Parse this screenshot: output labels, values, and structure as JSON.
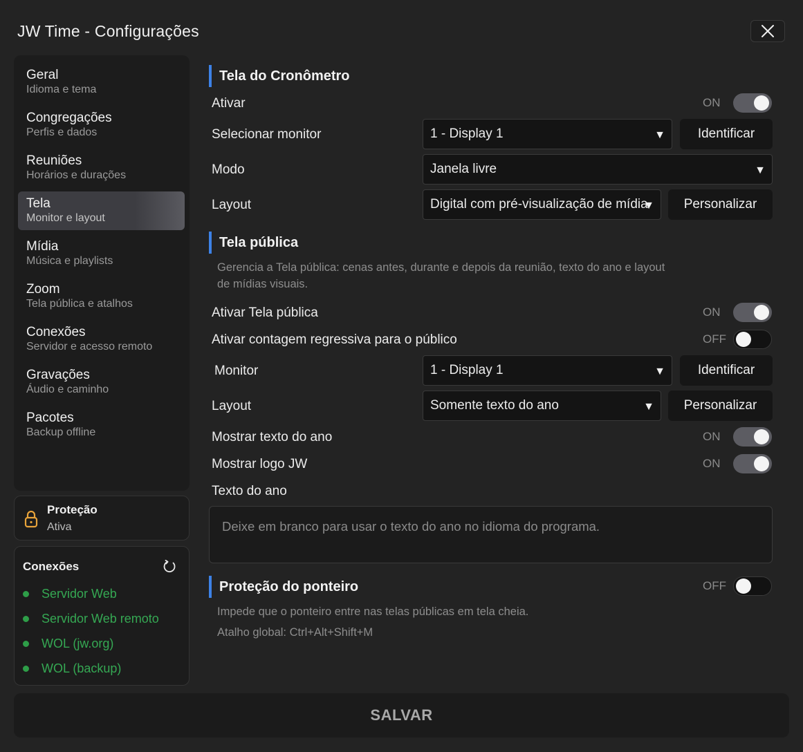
{
  "window": {
    "title": "JW Time - Configurações"
  },
  "sidebar": {
    "items": [
      {
        "label": "Geral",
        "sub": "Idioma e tema"
      },
      {
        "label": "Congregações",
        "sub": "Perfis e dados"
      },
      {
        "label": "Reuniões",
        "sub": "Horários e durações"
      },
      {
        "label": "Tela",
        "sub": "Monitor e layout",
        "active": true
      },
      {
        "label": "Mídia",
        "sub": "Música e playlists"
      },
      {
        "label": "Zoom",
        "sub": "Tela pública e atalhos"
      },
      {
        "label": "Conexões",
        "sub": "Servidor e acesso remoto"
      },
      {
        "label": "Gravações",
        "sub": "Áudio e caminho"
      },
      {
        "label": "Pacotes",
        "sub": "Backup offline"
      }
    ]
  },
  "protection": {
    "title": "Proteção",
    "status": "Ativa",
    "icon": "lock-icon",
    "color": "#e8a33a"
  },
  "connections": {
    "title": "Conexões",
    "items": [
      "Servidor Web",
      "Servidor Web remoto",
      "WOL (jw.org)",
      "WOL (backup)"
    ],
    "color": "#35a853"
  },
  "timer_screen": {
    "heading": "Tela do Cronômetro",
    "activate": {
      "label": "Ativar",
      "state": "ON"
    },
    "monitor": {
      "label": "Selecionar monitor",
      "value": "1 - Display 1",
      "button": "Identificar"
    },
    "mode": {
      "label": "Modo",
      "value": "Janela livre"
    },
    "layout": {
      "label": "Layout",
      "value": "Digital com pré-visualização de mídia",
      "button": "Personalizar"
    }
  },
  "public_screen": {
    "heading": "Tela pública",
    "description_line1": "Gerencia a Tela pública: cenas antes, durante e depois da reunião, texto do ano e layout",
    "description_line2": "de mídias visuais.",
    "enable": {
      "label": "Ativar Tela pública",
      "state": "ON"
    },
    "countdown": {
      "label": "Ativar contagem regressiva para o público",
      "state": "OFF"
    },
    "monitor": {
      "label": "Monitor",
      "value": "1 - Display 1",
      "button": "Identificar"
    },
    "layout": {
      "label": "Layout",
      "value": "Somente texto do ano",
      "button": "Personalizar"
    },
    "show_yeartext": {
      "label": "Mostrar texto do ano",
      "state": "ON"
    },
    "show_logo": {
      "label": "Mostrar logo JW",
      "state": "ON"
    },
    "yeartext": {
      "label": "Texto do ano",
      "placeholder": "Deixe em branco para usar o texto do ano no idioma do programa."
    }
  },
  "pointer_protection": {
    "heading": "Proteção do ponteiro",
    "state": "OFF",
    "description": "Impede que o ponteiro entre nas telas públicas em tela cheia.",
    "shortcut": "Atalho global: Ctrl+Alt+Shift+M"
  },
  "footer": {
    "save": "SALVAR"
  },
  "accent": "#3d82e6"
}
